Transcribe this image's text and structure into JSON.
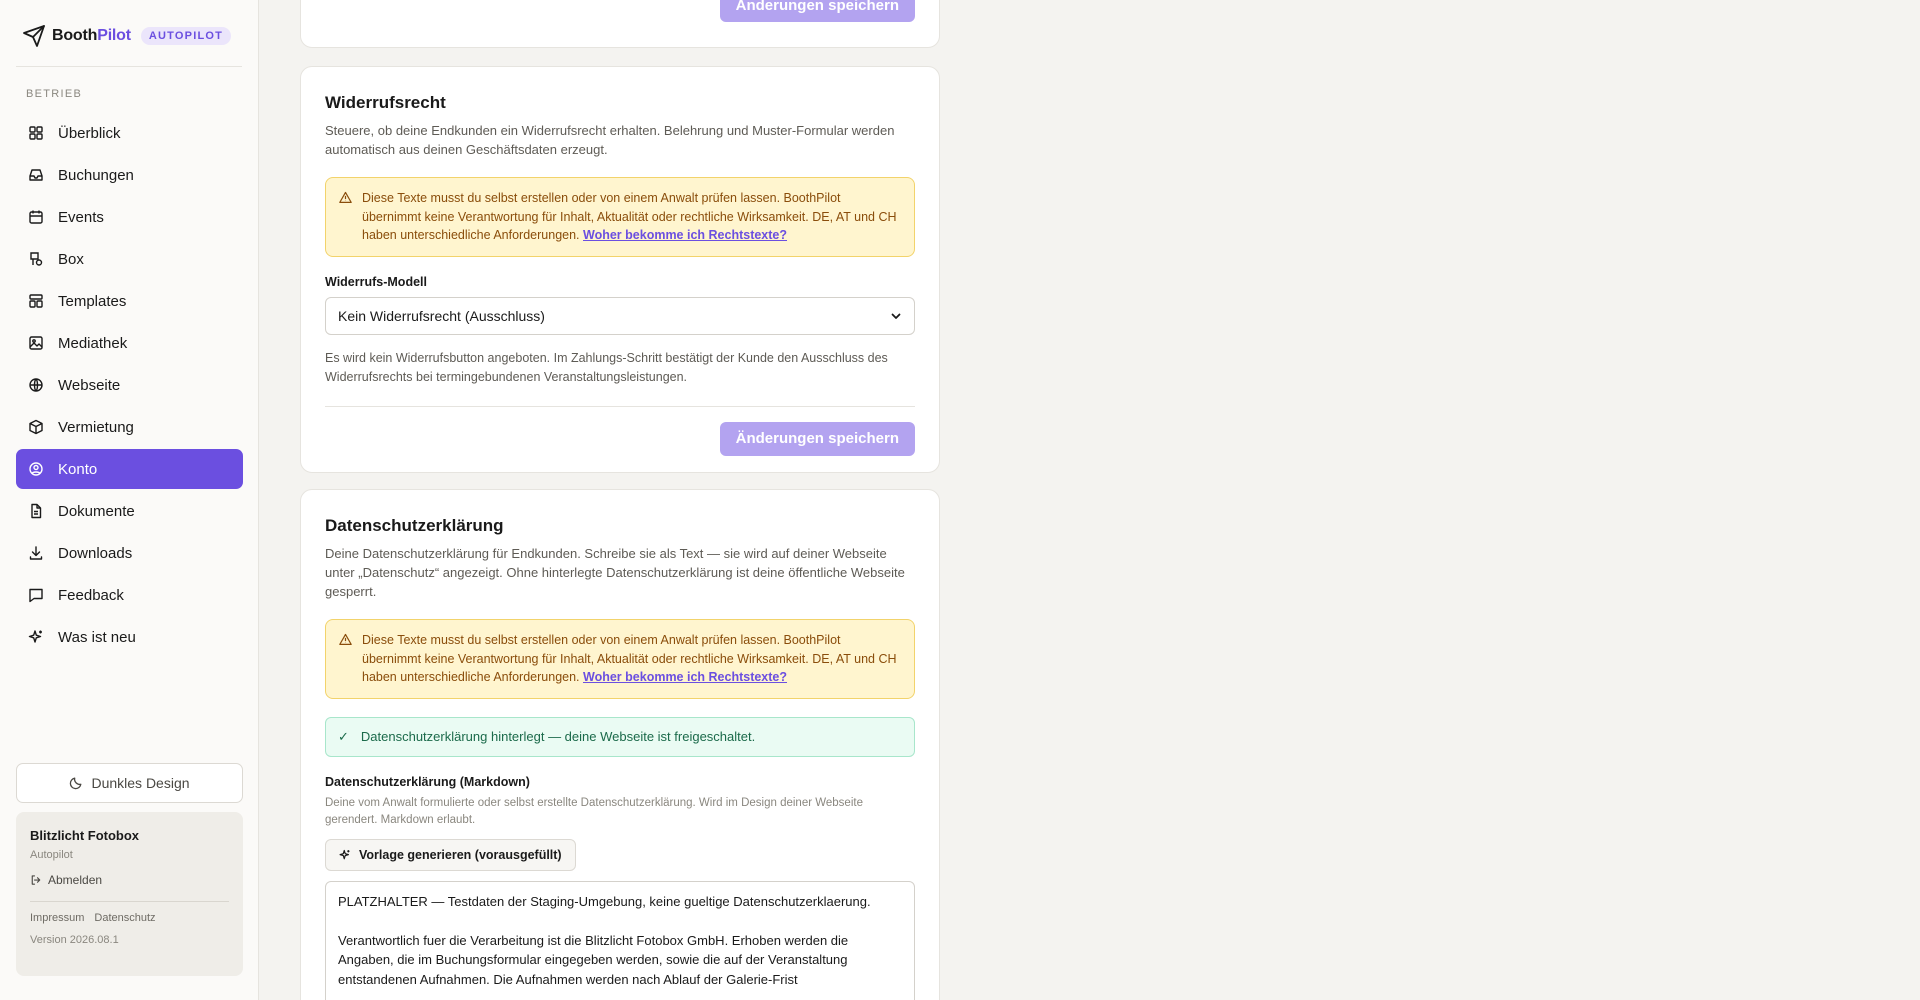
{
  "brand": {
    "name_part1": "Booth",
    "name_part2": "Pilot",
    "badge": "AUTOPILOT"
  },
  "sidebar": {
    "section_label": "BETRIEB",
    "items": [
      {
        "label": "Überblick",
        "icon": "dashboard-icon"
      },
      {
        "label": "Buchungen",
        "icon": "inbox-icon"
      },
      {
        "label": "Events",
        "icon": "calendar-icon"
      },
      {
        "label": "Box",
        "icon": "box-device-icon"
      },
      {
        "label": "Templates",
        "icon": "template-icon"
      },
      {
        "label": "Mediathek",
        "icon": "image-icon"
      },
      {
        "label": "Webseite",
        "icon": "globe-icon"
      },
      {
        "label": "Vermietung",
        "icon": "package-icon"
      },
      {
        "label": "Konto",
        "icon": "user-circle-icon",
        "active": true
      },
      {
        "label": "Dokumente",
        "icon": "file-icon"
      },
      {
        "label": "Downloads",
        "icon": "download-icon"
      },
      {
        "label": "Feedback",
        "icon": "message-icon"
      },
      {
        "label": "Was ist neu",
        "icon": "sparkle-icon"
      }
    ],
    "dark_mode_label": "Dunkles Design",
    "account": {
      "name": "Blitzlicht Fotobox",
      "plan": "Autopilot",
      "logout": "Abmelden",
      "link_impressum": "Impressum",
      "link_datenschutz": "Datenschutz",
      "version": "Version 2026.08.1"
    }
  },
  "top_card": {
    "save_label": "Änderungen speichern"
  },
  "widerruf": {
    "title": "Widerrufsrecht",
    "description": "Steuere, ob deine Endkunden ein Widerrufsrecht erhalten. Belehrung und Muster-Formular werden automatisch aus deinen Geschäftsdaten erzeugt.",
    "warning_text": "Diese Texte musst du selbst erstellen oder von einem Anwalt prüfen lassen. BoothPilot übernimmt keine Verantwortung für Inhalt, Aktualität oder rechtliche Wirksamkeit. DE, AT und CH haben unterschiedliche Anforderungen.",
    "warning_link": "Woher bekomme ich Rechtstexte?",
    "model_label": "Widerrufs-Modell",
    "model_value": "Kein Widerrufsrecht (Ausschluss)",
    "hint": "Es wird kein Widerrufsbutton angeboten. Im Zahlungs-Schritt bestätigt der Kunde den Ausschluss des Widerrufsrechts bei termingebundenen Veranstaltungsleistungen.",
    "save_label": "Änderungen speichern"
  },
  "datenschutz": {
    "title": "Datenschutzerklärung",
    "description": "Deine Datenschutzerklärung für Endkunden. Schreibe sie als Text — sie wird auf deiner Webseite unter „Datenschutz“ angezeigt. Ohne hinterlegte Datenschutzerklärung ist deine öffentliche Webseite gesperrt.",
    "warning_text": "Diese Texte musst du selbst erstellen oder von einem Anwalt prüfen lassen. BoothPilot übernimmt keine Verantwortung für Inhalt, Aktualität oder rechtliche Wirksamkeit. DE, AT und CH haben unterschiedliche Anforderungen.",
    "warning_link": "Woher bekomme ich Rechtstexte?",
    "success_check": "✓",
    "success_text": "Datenschutzerklärung hinterlegt — deine Webseite ist freigeschaltet.",
    "field_label": "Datenschutzerklärung (Markdown)",
    "field_hint": "Deine vom Anwalt formulierte oder selbst erstellte Datenschutzerklärung. Wird im Design deiner Webseite gerendert. Markdown erlaubt.",
    "generate_label": "Vorlage generieren (vorausgefüllt)",
    "textarea_value": "PLATZHALTER — Testdaten der Staging-Umgebung, keine gueltige Datenschutzerklaerung.\n\nVerantwortlich fuer die Verarbeitung ist die Blitzlicht Fotobox GmbH. Erhoben werden die Angaben, die im Buchungsformular eingegeben werden, sowie die auf der Veranstaltung entstandenen Aufnahmen. Die Aufnahmen werden nach Ablauf der Galerie-Frist"
  },
  "colors": {
    "accent": "#6b4fe0",
    "accent_disabled": "#b3a3f0",
    "warning_bg": "#fff5cf",
    "success_bg": "#eafbf3"
  }
}
